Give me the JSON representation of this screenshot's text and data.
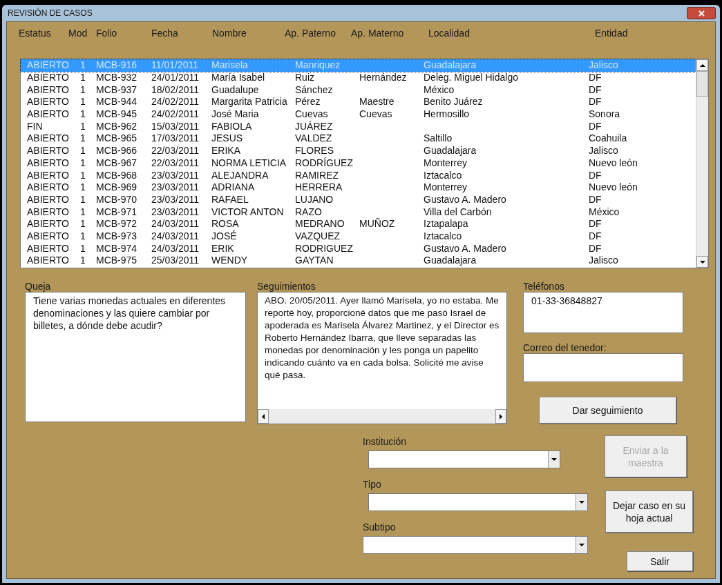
{
  "window": {
    "title": "REVISIÓN DE CASOS"
  },
  "table": {
    "columns": [
      "Estatus",
      "Mod",
      "Folio",
      "Fecha",
      "Nombre",
      "Ap. Paterno",
      "Ap. Materno",
      "Localidad",
      "Entidad"
    ],
    "rows": [
      {
        "selected": true,
        "cells": [
          "ABIERTO",
          "1",
          "MCB-916",
          "11/01/2011",
          "Marisela",
          "Manriquez",
          "",
          "Guadalajara",
          "Jalisco"
        ]
      },
      {
        "selected": false,
        "cells": [
          "ABIERTO",
          "1",
          "MCB-932",
          "24/01/2011",
          "María Isabel",
          "Ruiz",
          "Hernández",
          "Deleg. Miguel Hidalgo",
          "DF"
        ]
      },
      {
        "selected": false,
        "cells": [
          "ABIERTO",
          "1",
          "MCB-937",
          "18/02/2011",
          "Guadalupe",
          "Sánchez",
          "",
          "México",
          "DF"
        ]
      },
      {
        "selected": false,
        "cells": [
          "ABIERTO",
          "1",
          "MCB-944",
          "24/02/2011",
          "Margarita Patricia",
          "Pérez",
          "Maestre",
          "Benito Juárez",
          "DF"
        ]
      },
      {
        "selected": false,
        "cells": [
          "ABIERTO",
          "1",
          "MCB-945",
          "24/02/2011",
          "José Maria",
          "Cuevas",
          "Cuevas",
          "Hermosillo",
          "Sonora"
        ]
      },
      {
        "selected": false,
        "cells": [
          "FIN",
          "1",
          "MCB-962",
          "15/03/2011",
          "FABIOLA",
          "JUÁREZ",
          "",
          "",
          "DF"
        ]
      },
      {
        "selected": false,
        "cells": [
          "ABIERTO",
          "1",
          "MCB-965",
          "17/03/2011",
          "JESUS",
          "VALDEZ",
          "",
          "Saltillo",
          "Coahuila"
        ]
      },
      {
        "selected": false,
        "cells": [
          "ABIERTO",
          "1",
          "MCB-966",
          "22/03/2011",
          "ERIKA",
          "FLORES",
          "",
          "Guadalajara",
          "Jalisco"
        ]
      },
      {
        "selected": false,
        "cells": [
          "ABIERTO",
          "1",
          "MCB-967",
          "22/03/2011",
          "NORMA LETICIA",
          "RODRÍGUEZ",
          "",
          "Monterrey",
          "Nuevo león"
        ]
      },
      {
        "selected": false,
        "cells": [
          "ABIERTO",
          "1",
          "MCB-968",
          "23/03/2011",
          "ALEJANDRA",
          "RAMIREZ",
          "",
          "Iztacalco",
          "DF"
        ]
      },
      {
        "selected": false,
        "cells": [
          "ABIERTO",
          "1",
          "MCB-969",
          "23/03/2011",
          "ADRIANA",
          "HERRERA",
          "",
          "Monterrey",
          "Nuevo león"
        ]
      },
      {
        "selected": false,
        "cells": [
          "ABIERTO",
          "1",
          "MCB-970",
          "23/03/2011",
          "RAFAEL",
          "LUJANO",
          "",
          "Gustavo A. Madero",
          "DF"
        ]
      },
      {
        "selected": false,
        "cells": [
          "ABIERTO",
          "1",
          "MCB-971",
          "23/03/2011",
          "VICTOR ANTON",
          "RAZO",
          "",
          "Villa del Carbón",
          "México"
        ]
      },
      {
        "selected": false,
        "cells": [
          "ABIERTO",
          "1",
          "MCB-972",
          "24/03/2011",
          "ROSA",
          "MEDRANO",
          "MUÑOZ",
          "Iztapalapa",
          "DF"
        ]
      },
      {
        "selected": false,
        "cells": [
          "ABIERTO",
          "1",
          "MCB-973",
          "24/03/2011",
          "JOSÉ",
          "VAZQUEZ",
          "",
          "Iztacalco",
          "DF"
        ]
      },
      {
        "selected": false,
        "cells": [
          "ABIERTO",
          "1",
          "MCB-974",
          "24/03/2011",
          "ERIK",
          "RODRIGUEZ",
          "",
          "Gustavo A. Madero",
          "DF"
        ]
      },
      {
        "selected": false,
        "cells": [
          "ABIERTO",
          "1",
          "MCB-975",
          "25/03/2011",
          "WENDY",
          "GAYTAN",
          "",
          "Guadalajara",
          "Jalisco"
        ]
      }
    ]
  },
  "queja": {
    "label": "Queja",
    "value": "Tiene varias monedas actuales en diferentes denominaciones y las quiere cambiar por billetes, a dónde debe acudir?"
  },
  "seguimientos": {
    "label": "Seguimientos",
    "value": "ABO. 20/05/2011. Ayer llamó Marisela, yo no estaba.  Me reporté hoy, proporcioné datos que me pasó Israel de apoderada es Marisela Álvarez Martinez, y el Director es Roberto Hernández Ibarra, que lleve separadas las monedas por denominación y les ponga un papelito indicando cuánto va en cada bolsa. Solicité me avise qué pasa."
  },
  "telefonos": {
    "label": "Teléfonos",
    "value": "01-33-36848827"
  },
  "correo": {
    "label": "Correo del tenedor:"
  },
  "follow_button": {
    "label": "Dar seguimiento",
    "disabled": false
  },
  "combos": [
    {
      "label": "Institución"
    },
    {
      "label": "Tipo"
    },
    {
      "label": "Subtipo"
    }
  ],
  "buttons": [
    {
      "label": "Enviar a la maestra",
      "disabled": true
    },
    {
      "label": "Dejar caso en su hoja actual",
      "disabled": false
    },
    {
      "label": "Salir",
      "disabled": false
    }
  ]
}
